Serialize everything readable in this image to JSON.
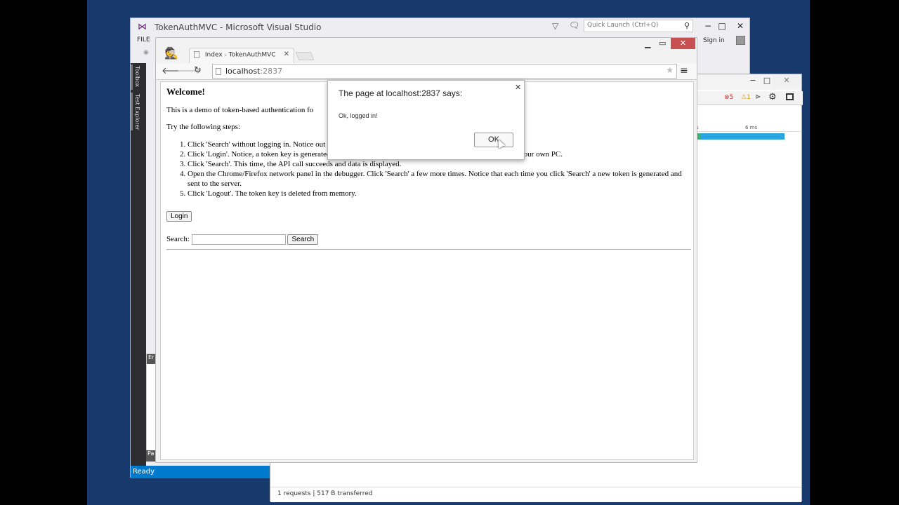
{
  "vs": {
    "title": "TokenAuthMVC - Microsoft Visual Studio",
    "quick_launch": "Quick Launch (Ctrl+Q)",
    "menu_file": "FILE",
    "sign_in": "Sign in",
    "side_tabs": [
      "Toolbox",
      "Test Explorer"
    ],
    "panel_label": "Er",
    "panel_foot": "Pa",
    "status": "Ready",
    "controls": {
      "minimize": "−",
      "maximize": "□",
      "close": "✕"
    }
  },
  "devtools": {
    "errors": "5",
    "warnings": "1",
    "ruler_label": "6 ms",
    "ruler_prefix": "s",
    "status": "1 requests  |  517 B transferred"
  },
  "chrome": {
    "tab_title": "Index - TokenAuthMVC",
    "url_host": "localhost",
    "url_port": ":2837",
    "page": {
      "heading": "Welcome!",
      "intro": "This is a demo of token-based authentication fo",
      "steps_intro": "Try the following steps:",
      "steps": [
        "Click 'Search' without logging in. Notice                                                   out the Chrome/Firefox network panel in the debugger for proof.",
        "Click 'Login'. Notice, a token key is generated in memory, yet never sent to the server. The key is safely on your own PC.",
        "Click 'Search'. This time, the API call succeeds and data is displayed.",
        "Open the Chrome/Firefox network panel in the debugger. Click 'Search' a few more times. Notice that each time you click 'Search' a new token is generated and sent to the server.",
        "Click 'Logout'. The token key is deleted from memory."
      ],
      "login_button": "Login",
      "search_label": "Search:",
      "search_value": "",
      "search_button": "Search"
    }
  },
  "dialog": {
    "title": "The page at localhost:2837 says:",
    "message": "Ok, logged in!",
    "ok_button": "OK"
  }
}
